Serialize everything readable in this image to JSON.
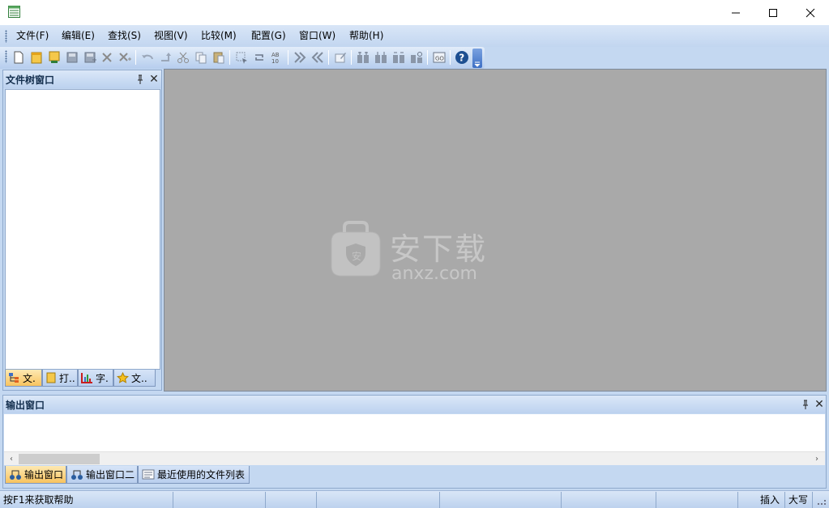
{
  "window": {
    "controls": {
      "minimize": "—",
      "maximize": "☐",
      "close": "✕"
    }
  },
  "menu": {
    "items": [
      "文件(F)",
      "编辑(E)",
      "查找(S)",
      "视图(V)",
      "比较(M)",
      "配置(G)",
      "窗口(W)",
      "帮助(H)"
    ]
  },
  "toolbar": {
    "icons": [
      "new-file-icon",
      "open-folder-icon",
      "open-project-icon",
      "save-icon",
      "save-all-icon",
      "delete-icon",
      "delete-all-icon",
      "undo-icon",
      "redo-icon",
      "cut-icon",
      "copy-icon",
      "paste-icon",
      "select-icon",
      "refresh-icon",
      "sort-icon",
      "next-diff-icon",
      "prev-diff-icon",
      "edit-icon",
      "compare-icon",
      "compare-left-icon",
      "compare-right-icon",
      "compare-tools-icon",
      "goto-icon",
      "help-icon"
    ]
  },
  "tree_pane": {
    "title": "文件树窗口",
    "pin": "📌",
    "close": "✕",
    "tabs": [
      {
        "label": "文.",
        "icon": "file-tree-icon",
        "active": true
      },
      {
        "label": "打..",
        "icon": "open-files-icon",
        "active": false
      },
      {
        "label": "字.",
        "icon": "chart-icon",
        "active": false
      },
      {
        "label": "文..",
        "icon": "star-icon",
        "active": false
      }
    ]
  },
  "watermark": {
    "logo_text": "安下载",
    "domain_text": "anxz.com"
  },
  "output_pane": {
    "title": "输出窗口",
    "tabs": [
      {
        "label": "输出窗口",
        "icon": "output-icon",
        "active": true
      },
      {
        "label": "输出窗口二",
        "icon": "output-icon",
        "active": false
      },
      {
        "label": "最近使用的文件列表",
        "icon": "recent-files-icon",
        "active": false
      }
    ],
    "scroll_left": "‹",
    "scroll_right": "›"
  },
  "statusbar": {
    "help_text": "按F1来获取帮助",
    "insert": "插入",
    "caps": "大写"
  },
  "colors": {
    "chrome": "#c4d8f1",
    "mdi_background": "#a9a9a9",
    "active_tab": "#f8c35f"
  }
}
